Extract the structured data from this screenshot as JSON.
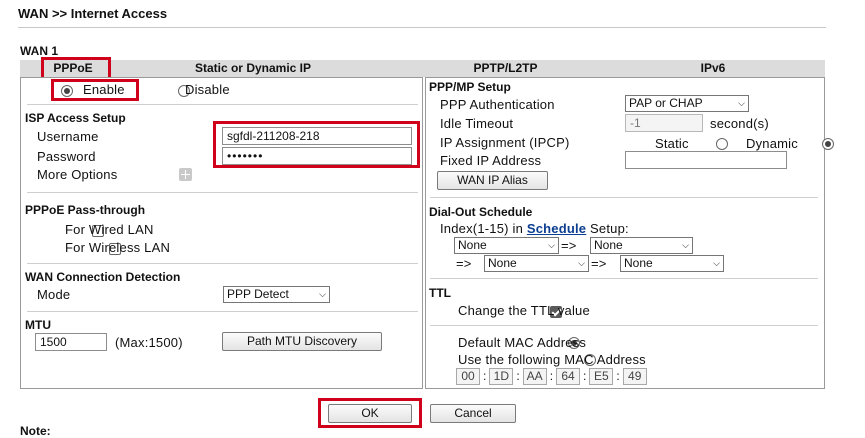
{
  "breadcrumb": "WAN >> Internet Access",
  "section_label": "WAN 1",
  "tabs": [
    "PPPoE",
    "Static or Dynamic IP",
    "PPTP/L2TP",
    "IPv6"
  ],
  "status": {
    "enable": "Enable",
    "disable": "Disable",
    "selected": "Enable"
  },
  "isp": {
    "title": "ISP Access Setup",
    "username_label": "Username",
    "username_value": "sgfdl-211208-218",
    "password_label": "Password",
    "password_value": "•••••••",
    "more_options": "More Options"
  },
  "passthrough": {
    "title": "PPPoE Pass-through",
    "wired": "For Wired LAN",
    "wireless": "For Wireless LAN"
  },
  "detection": {
    "title": "WAN Connection Detection",
    "mode_label": "Mode",
    "mode_value": "PPP Detect"
  },
  "mtu": {
    "title": "MTU",
    "value": "1500",
    "max": "(Max:1500)",
    "discover_button": "Path MTU Discovery"
  },
  "pppmp": {
    "title": "PPP/MP Setup",
    "auth_label": "PPP Authentication",
    "auth_value": "PAP or CHAP",
    "idle_label": "Idle Timeout",
    "idle_value": "-1",
    "idle_unit": "second(s)",
    "ipcp_label": "IP Assignment (IPCP)",
    "ipcp_static": "Static",
    "ipcp_dynamic": "Dynamic",
    "fixed_ip_label": "Fixed IP Address",
    "fixed_ip_value": "",
    "alias_button": "WAN IP Alias"
  },
  "dialout": {
    "title": "Dial-Out Schedule",
    "index_prefix": "Index(1-15) in",
    "schedule_link": "Schedule",
    "setup_suffix": "Setup:",
    "arrow": "=>",
    "slots": [
      "None",
      "None",
      "None",
      "None"
    ]
  },
  "ttl": {
    "title": "TTL",
    "change_label": "Change the TTL value"
  },
  "mac": {
    "default_label": "Default MAC Address",
    "custom_label": "Use the following MAC Address",
    "segments": [
      "00",
      "1D",
      "AA",
      "64",
      "E5",
      "49"
    ]
  },
  "actions": {
    "ok": "OK",
    "cancel": "Cancel"
  },
  "footer": {
    "note": "Note:"
  },
  "colors": {
    "highlight": "#d0021b",
    "link": "#0b3d91"
  }
}
